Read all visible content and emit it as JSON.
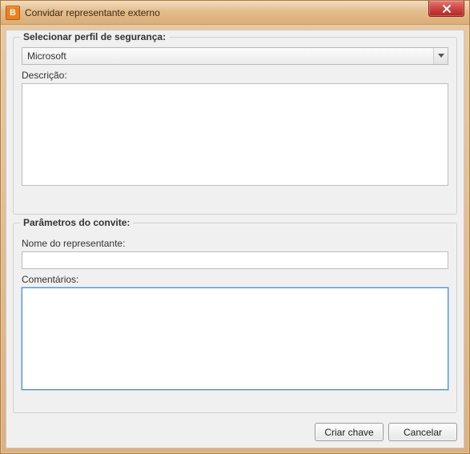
{
  "window": {
    "app_icon_letter": "B",
    "title": "Convidar representante externo"
  },
  "group_security": {
    "legend": "Selecionar perfil de segurança:",
    "profile_selected": "Microsoft",
    "description_label": "Descrição:",
    "description_value": ""
  },
  "group_invite": {
    "legend": "Parâmetros do convite:",
    "rep_name_label": "Nome do representante:",
    "rep_name_value": "",
    "comments_label": "Comentários:",
    "comments_value": ""
  },
  "buttons": {
    "create_key": "Criar chave",
    "cancel": "Cancelar"
  }
}
